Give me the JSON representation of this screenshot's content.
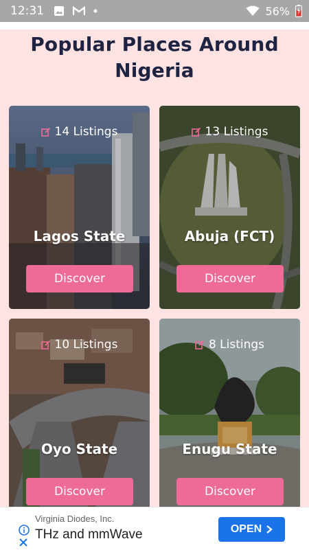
{
  "status": {
    "time": "12:31",
    "battery": "56%"
  },
  "page": {
    "title": "Popular Places Around Nigeria"
  },
  "places": [
    {
      "listings": "14 Listings",
      "name": "Lagos State",
      "button": "Discover"
    },
    {
      "listings": "13 Listings",
      "name": "Abuja (FCT)",
      "button": "Discover"
    },
    {
      "listings": "10 Listings",
      "name": "Oyo State",
      "button": "Discover"
    },
    {
      "listings": "8 Listings",
      "name": "Enugu State",
      "button": "Discover"
    }
  ],
  "ad": {
    "advertiser": "Virginia Diodes, Inc.",
    "headline": "THz and mmWave",
    "cta": "OPEN"
  },
  "colors": {
    "accent": "#ee6a97",
    "background": "#ffe3e3",
    "title": "#1f2342"
  },
  "icons": [
    "image-icon",
    "gmail-icon",
    "wifi-icon",
    "battery-icon",
    "edit-icon",
    "info-icon",
    "close-icon",
    "chevron-right-icon"
  ]
}
